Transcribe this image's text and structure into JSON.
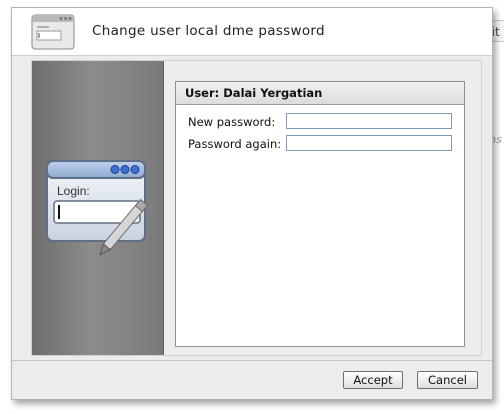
{
  "background": {
    "tab_fragment": "dit",
    "text_fragment": "ups"
  },
  "dialog": {
    "title": "Change user local dme password",
    "header_icon": "window-form-icon",
    "side_image_icon": "login-window-icon",
    "side_image_text": "Login:",
    "user_heading": "User: Dalai Yergatian",
    "fields": {
      "new_password": {
        "label": "New password:",
        "value": ""
      },
      "password_again": {
        "label": "Password again:",
        "value": ""
      }
    },
    "buttons": {
      "accept": "Accept",
      "cancel": "Cancel"
    }
  },
  "colors": {
    "dialog_bg": "#ececec",
    "side_panel": "#7a7a7a",
    "input_border": "#7f9db9",
    "icon_blue": "#3b6fd6"
  }
}
